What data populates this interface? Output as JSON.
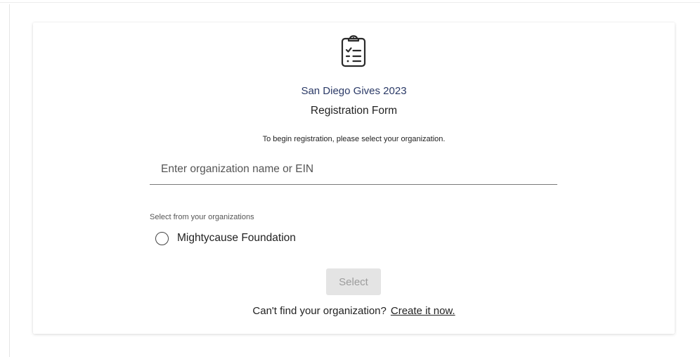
{
  "form": {
    "event_title": "San Diego Gives 2023",
    "form_title": "Registration Form",
    "instructions": "To begin registration, please select your organization.",
    "search_placeholder": "Enter organization name or EIN",
    "orgs_label": "Select from your organizations",
    "organizations": [
      {
        "name": "Mightycause Foundation",
        "selected": false
      }
    ],
    "select_button_label": "Select",
    "footer_prompt": "Can't find your organization?",
    "create_link_label": "Create it now."
  },
  "icons": {
    "header": "clipboard-checklist-icon",
    "radio": "radio-unchecked-icon"
  },
  "colors": {
    "event_title": "#2b3a67",
    "button_disabled_bg": "#e4e4e4",
    "button_disabled_text": "#9c9c9c"
  }
}
